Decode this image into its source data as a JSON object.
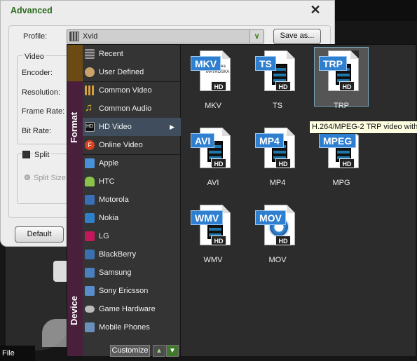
{
  "dialog": {
    "title": "Advanced",
    "close": "✕",
    "profile_label": "Profile:",
    "profile_value": "Xvid",
    "save_as": "Save as...",
    "video_group": "Video",
    "fields": [
      "Encoder:",
      "Resolution:",
      "Frame Rate:",
      "Bit Rate:"
    ],
    "split_label": "Split",
    "split_size": "Split Size",
    "default_button": "Default"
  },
  "popup": {
    "format_tab": "Format",
    "device_tab": "Device",
    "categories": [
      {
        "label": "Recent",
        "icon": "recent-icon"
      },
      {
        "label": "User Defined",
        "icon": "user-icon"
      },
      {
        "label": "Common Video",
        "icon": "film-icon"
      },
      {
        "label": "Common Audio",
        "icon": "music-note-icon"
      },
      {
        "label": "HD Video",
        "icon": "hd-icon",
        "selected": true
      },
      {
        "label": "Online Video",
        "icon": "flash-icon"
      },
      {
        "label": "Apple",
        "icon": "ipod-icon"
      },
      {
        "label": "HTC",
        "icon": "android-icon"
      },
      {
        "label": "Motorola",
        "icon": "phone-icon"
      },
      {
        "label": "Nokia",
        "icon": "phone-icon"
      },
      {
        "label": "LG",
        "icon": "phone-icon"
      },
      {
        "label": "BlackBerry",
        "icon": "phone-icon"
      },
      {
        "label": "Samsung",
        "icon": "phone-icon"
      },
      {
        "label": "Sony Ericsson",
        "icon": "phone-icon"
      },
      {
        "label": "Game Hardware",
        "icon": "gamepad-icon"
      },
      {
        "label": "Mobile Phones",
        "icon": "phone-icon"
      }
    ],
    "customize": "Customize",
    "formats": [
      {
        "badge": "MKV",
        "label": "MKV",
        "hd": "HD",
        "matroska": "матрёшка MATROSKA"
      },
      {
        "badge": "TS",
        "label": "TS",
        "hd": "HD"
      },
      {
        "badge": "TRP",
        "label": "TRP",
        "hd": "HD",
        "selected": true
      },
      {
        "badge": "AVI",
        "label": "AVI",
        "hd": "HD"
      },
      {
        "badge": "MP4",
        "label": "MP4",
        "hd": "HD"
      },
      {
        "badge": "MPEG",
        "label": "MPG",
        "hd": "HD"
      },
      {
        "badge": "WMV",
        "label": "WMV",
        "hd": "HD"
      },
      {
        "badge": "MOV",
        "label": "MOV",
        "hd": "HD"
      }
    ],
    "tooltip": "H.264/MPEG-2 TRP video with"
  },
  "app": {
    "file_menu": "File"
  },
  "colors": {
    "title_green": "#2c6b1f",
    "badge_blue": "#2f7fd0",
    "selected_row": "#3f4d5c",
    "tab_purple": "#4a1f3c"
  }
}
